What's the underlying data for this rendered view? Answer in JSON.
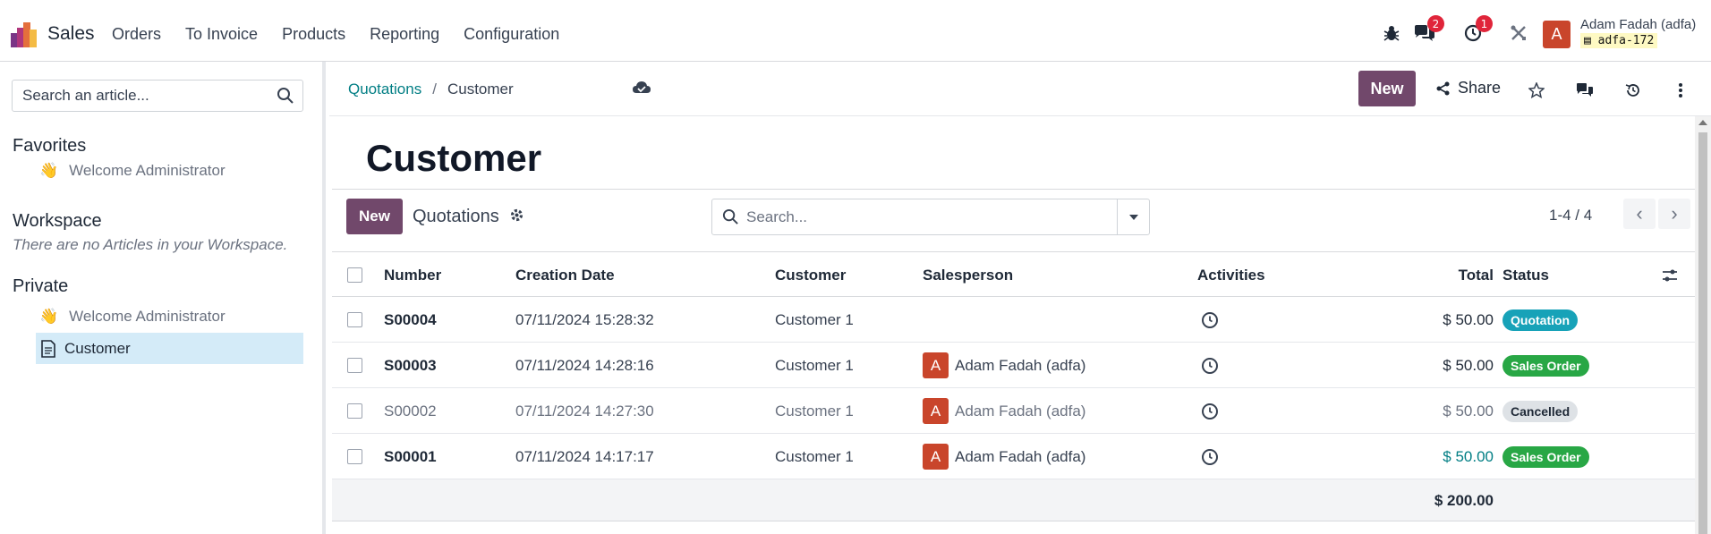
{
  "navbar": {
    "app_name": "Sales",
    "menu": [
      "Orders",
      "To Invoice",
      "Products",
      "Reporting",
      "Configuration"
    ],
    "chat_count": "2",
    "activity_count": "1",
    "user_initial": "A",
    "user_name": "Adam Fadah (adfa)",
    "user_db": "adfa-172",
    "logo_colors": [
      "#f4bb44",
      "#e46f3c",
      "#b0367c",
      "#7a3586"
    ],
    "avatar_color": "#c9452b"
  },
  "sidebar": {
    "search_placeholder": "Search an article...",
    "favorites_heading": "Favorites",
    "favorites": [
      {
        "emoji": "👋",
        "label": "Welcome Administrator"
      }
    ],
    "workspace_heading": "Workspace",
    "workspace_empty": "There are no Articles in your Workspace.",
    "private_heading": "Private",
    "private_items": [
      {
        "emoji": "👋",
        "label": "Welcome Administrator"
      }
    ],
    "active_item": {
      "icon": "document-icon",
      "label": "Customer"
    }
  },
  "main": {
    "breadcrumb_link": "Quotations",
    "breadcrumb_sep": "/",
    "breadcrumb_current": "Customer",
    "new_label": "New",
    "share_label": "Share",
    "title": "Customer",
    "accent_color": "#71486b"
  },
  "list": {
    "new_label": "New",
    "name": "Quotations",
    "search_placeholder": "Search...",
    "pager": "1-4 / 4",
    "columns": {
      "number": "Number",
      "creation_date": "Creation Date",
      "customer": "Customer",
      "salesperson": "Salesperson",
      "activities": "Activities",
      "total": "Total",
      "status": "Status"
    },
    "rows": [
      {
        "number": "S00004",
        "date": "07/11/2024 15:28:32",
        "customer": "Customer 1",
        "salesperson": "",
        "initial": "",
        "total": "$ 50.00",
        "status": "Quotation",
        "status_color": "#17a2b8"
      },
      {
        "number": "S00003",
        "date": "07/11/2024 14:28:16",
        "customer": "Customer 1",
        "salesperson": "Adam Fadah (adfa)",
        "initial": "A",
        "total": "$ 50.00",
        "status": "Sales Order",
        "status_color": "#28a745"
      },
      {
        "number": "S00002",
        "date": "07/11/2024 14:27:30",
        "customer": "Customer 1",
        "salesperson": "Adam Fadah (adfa)",
        "initial": "A",
        "total": "$ 50.00",
        "status": "Cancelled",
        "status_color": "#dee2e6"
      },
      {
        "number": "S00001",
        "date": "07/11/2024 14:17:17",
        "customer": "Customer 1",
        "salesperson": "Adam Fadah (adfa)",
        "initial": "A",
        "total": "$ 50.00",
        "status": "Sales Order",
        "status_color": "#28a745"
      }
    ],
    "grand_total": "$ 200.00"
  }
}
